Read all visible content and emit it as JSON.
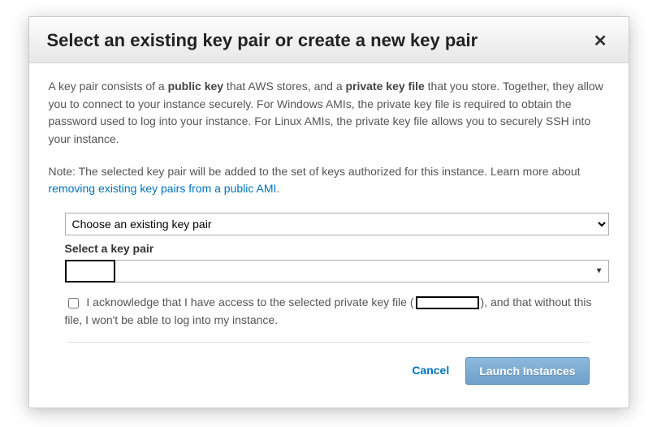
{
  "header": {
    "title": "Select an existing key pair or create a new key pair"
  },
  "description": {
    "p1_a": "A key pair consists of a ",
    "p1_bold1": "public key",
    "p1_b": " that AWS stores, and a ",
    "p1_bold2": "private key file",
    "p1_c": " that you store. Together, they allow you to connect to your instance securely. For Windows AMIs, the private key file is required to obtain the password used to log into your instance. For Linux AMIs, the private key file allows you to securely SSH into your instance.",
    "p2_a": "Note: The selected key pair will be added to the set of keys authorized for this instance. Learn more about ",
    "p2_link": "removing existing key pairs from a public AMI",
    "p2_b": "."
  },
  "form": {
    "mode_selected": "Choose an existing key pair",
    "keypair_label": "Select a key pair"
  },
  "ack": {
    "text_a": "I acknowledge that I have access to the selected private key file (",
    "text_b": "), and that without this file, I won't be able to log into my instance."
  },
  "footer": {
    "cancel": "Cancel",
    "launch": "Launch Instances"
  }
}
